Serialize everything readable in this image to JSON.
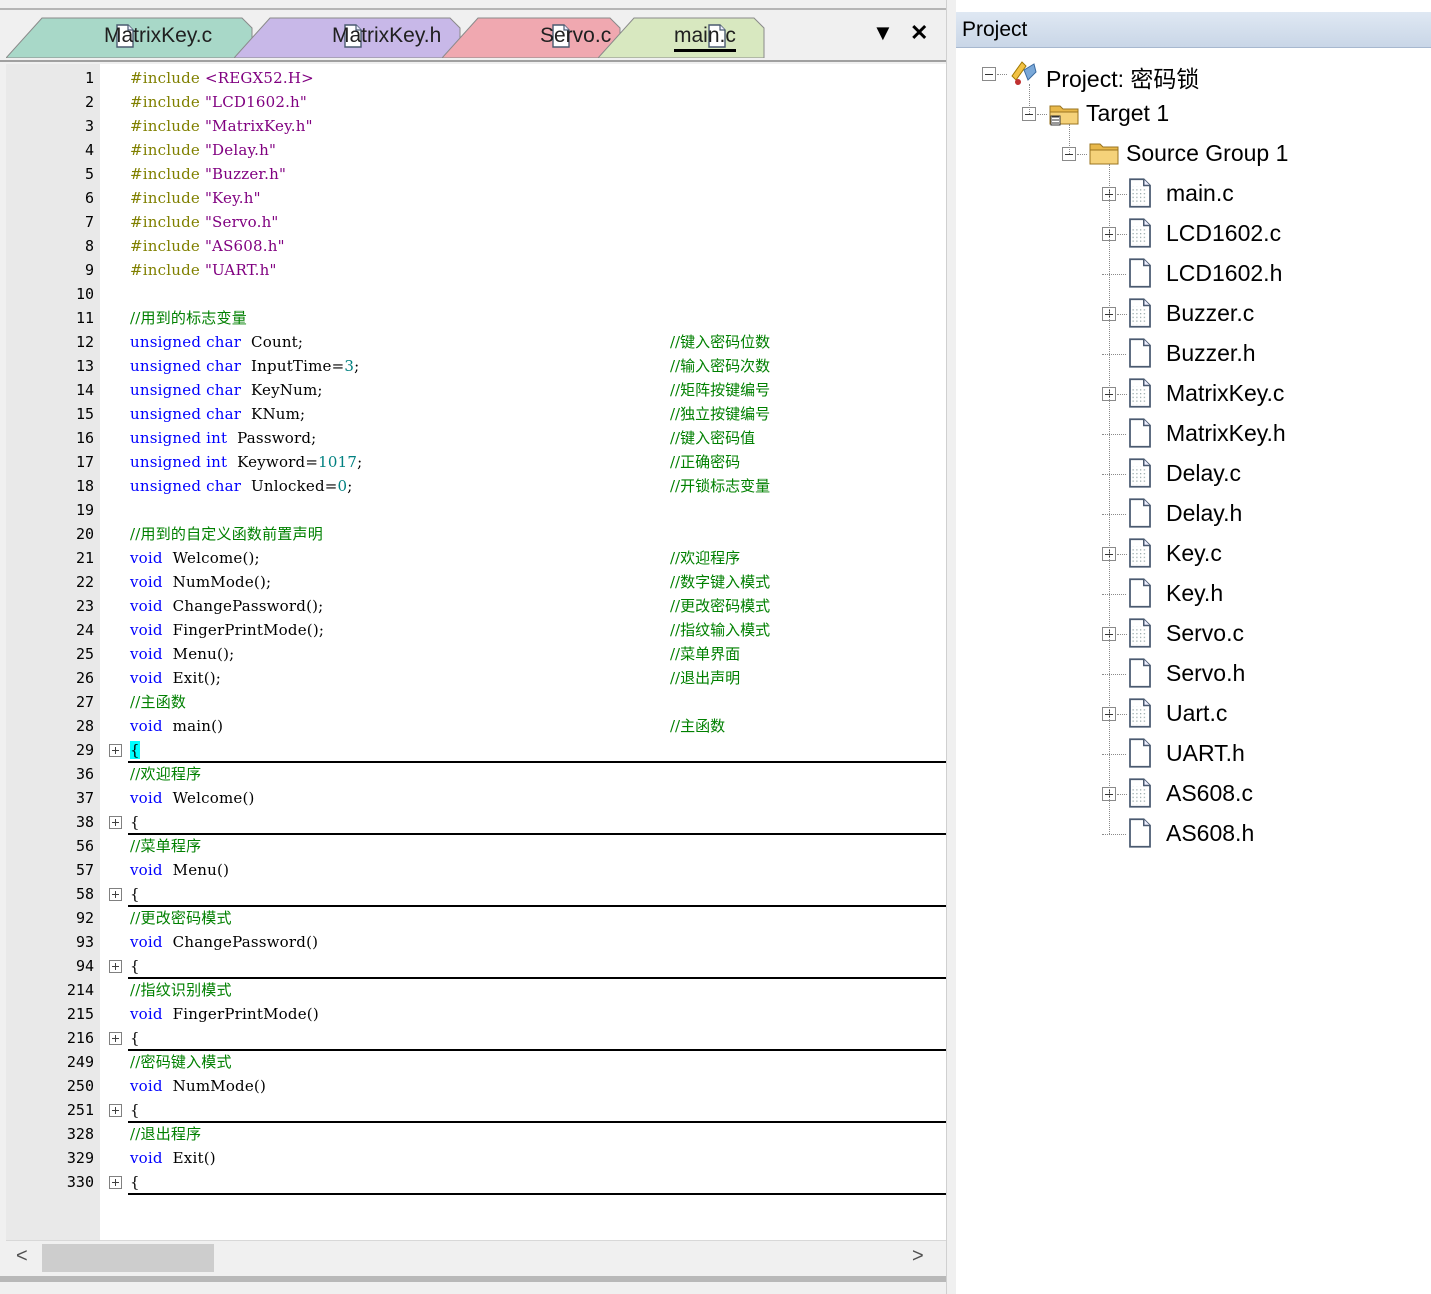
{
  "editor": {
    "tabs": [
      {
        "label": "MatrixKey.c",
        "color": "#a8d8c8"
      },
      {
        "label": "MatrixKey.h",
        "color": "#c8b8e8"
      },
      {
        "label": "Servo.c",
        "color": "#f0a8b0"
      },
      {
        "label": "main.c",
        "color": "#d8e8c0",
        "active": true
      }
    ],
    "dropdown_icon": "▼",
    "close_icon": "✕",
    "lines": [
      {
        "n": "1",
        "html": [
          [
            "pp",
            "#include "
          ],
          [
            "str",
            "&lt;REGX52.H&gt;"
          ]
        ]
      },
      {
        "n": "2",
        "html": [
          [
            "pp",
            "#include "
          ],
          [
            "str",
            "\"LCD1602.h\""
          ]
        ]
      },
      {
        "n": "3",
        "html": [
          [
            "pp",
            "#include "
          ],
          [
            "str",
            "\"MatrixKey.h\""
          ]
        ]
      },
      {
        "n": "4",
        "html": [
          [
            "pp",
            "#include "
          ],
          [
            "str",
            "\"Delay.h\""
          ]
        ]
      },
      {
        "n": "5",
        "html": [
          [
            "pp",
            "#include "
          ],
          [
            "str",
            "\"Buzzer.h\""
          ]
        ]
      },
      {
        "n": "6",
        "html": [
          [
            "pp",
            "#include "
          ],
          [
            "str",
            "\"Key.h\""
          ]
        ]
      },
      {
        "n": "7",
        "html": [
          [
            "pp",
            "#include "
          ],
          [
            "str",
            "\"Servo.h\""
          ]
        ]
      },
      {
        "n": "8",
        "html": [
          [
            "pp",
            "#include "
          ],
          [
            "str",
            "\"AS608.h\""
          ]
        ]
      },
      {
        "n": "9",
        "html": [
          [
            "pp",
            "#include "
          ],
          [
            "str",
            "\"UART.h\""
          ]
        ]
      },
      {
        "n": "10",
        "html": []
      },
      {
        "n": "11",
        "html": [
          [
            "cmt",
            "//用到的标志变量"
          ]
        ]
      },
      {
        "n": "12",
        "html": [
          [
            "kw",
            "unsigned char"
          ],
          [
            "",
            "  Count;"
          ]
        ],
        "cm": "//键入密码位数"
      },
      {
        "n": "13",
        "html": [
          [
            "kw",
            "unsigned char"
          ],
          [
            "",
            "  InputTime="
          ],
          [
            "num",
            "3"
          ],
          [
            "",
            ";"
          ]
        ],
        "cm": "//输入密码次数"
      },
      {
        "n": "14",
        "html": [
          [
            "kw",
            "unsigned char"
          ],
          [
            "",
            "  KeyNum;"
          ]
        ],
        "cm": "//矩阵按键编号"
      },
      {
        "n": "15",
        "html": [
          [
            "kw",
            "unsigned char"
          ],
          [
            "",
            "  KNum;"
          ]
        ],
        "cm": "//独立按键编号"
      },
      {
        "n": "16",
        "html": [
          [
            "kw",
            "unsigned int"
          ],
          [
            "",
            "  Password;"
          ]
        ],
        "cm": "//键入密码值"
      },
      {
        "n": "17",
        "html": [
          [
            "kw",
            "unsigned int"
          ],
          [
            "",
            "  Keyword="
          ],
          [
            "num",
            "1017"
          ],
          [
            "",
            ";"
          ]
        ],
        "cm": "//正确密码"
      },
      {
        "n": "18",
        "html": [
          [
            "kw",
            "unsigned char"
          ],
          [
            "",
            "  Unlocked="
          ],
          [
            "num",
            "0"
          ],
          [
            "",
            ";"
          ]
        ],
        "cm": "//开锁标志变量"
      },
      {
        "n": "19",
        "html": []
      },
      {
        "n": "20",
        "html": [
          [
            "cmt",
            "//用到的自定义函数前置声明"
          ]
        ]
      },
      {
        "n": "21",
        "html": [
          [
            "kw",
            "void"
          ],
          [
            "",
            "  Welcome();"
          ]
        ],
        "cm": "//欢迎程序"
      },
      {
        "n": "22",
        "html": [
          [
            "kw",
            "void"
          ],
          [
            "",
            "  NumMode();"
          ]
        ],
        "cm": "//数字键入模式"
      },
      {
        "n": "23",
        "html": [
          [
            "kw",
            "void"
          ],
          [
            "",
            "  ChangePassword();"
          ]
        ],
        "cm": "//更改密码模式"
      },
      {
        "n": "24",
        "html": [
          [
            "kw",
            "void"
          ],
          [
            "",
            "  FingerPrintMode();"
          ]
        ],
        "cm": "//指纹输入模式"
      },
      {
        "n": "25",
        "html": [
          [
            "kw",
            "void"
          ],
          [
            "",
            "  Menu();"
          ]
        ],
        "cm": "//菜单界面"
      },
      {
        "n": "26",
        "html": [
          [
            "kw",
            "void"
          ],
          [
            "",
            "  Exit();"
          ]
        ],
        "cm": "//退出声明"
      },
      {
        "n": "27",
        "html": [
          [
            "cmt",
            "//主函数"
          ]
        ]
      },
      {
        "n": "28",
        "html": [
          [
            "kw",
            "void"
          ],
          [
            "",
            "  main()"
          ]
        ],
        "cm": "//主函数"
      },
      {
        "n": "29",
        "html": [
          [
            "cur",
            "{"
          ]
        ],
        "fold": true
      },
      {
        "n": "36",
        "html": [
          [
            "cmt",
            "//欢迎程序"
          ]
        ]
      },
      {
        "n": "37",
        "html": [
          [
            "kw",
            "void"
          ],
          [
            "",
            "  Welcome()"
          ]
        ]
      },
      {
        "n": "38",
        "html": [
          [
            "",
            "{"
          ]
        ],
        "fold": true
      },
      {
        "n": "56",
        "html": [
          [
            "cmt",
            "//菜单程序"
          ]
        ]
      },
      {
        "n": "57",
        "html": [
          [
            "kw",
            "void"
          ],
          [
            "",
            "  Menu()"
          ]
        ]
      },
      {
        "n": "58",
        "html": [
          [
            "",
            "{"
          ]
        ],
        "fold": true
      },
      {
        "n": "92",
        "html": [
          [
            "cmt",
            "//更改密码模式"
          ]
        ]
      },
      {
        "n": "93",
        "html": [
          [
            "kw",
            "void"
          ],
          [
            "",
            "  ChangePassword()"
          ]
        ]
      },
      {
        "n": "94",
        "html": [
          [
            "",
            "{"
          ]
        ],
        "fold": true
      },
      {
        "n": "214",
        "html": [
          [
            "cmt",
            "//指纹识别模式"
          ]
        ]
      },
      {
        "n": "215",
        "html": [
          [
            "kw",
            "void"
          ],
          [
            "",
            "  FingerPrintMode()"
          ]
        ]
      },
      {
        "n": "216",
        "html": [
          [
            "",
            "{"
          ]
        ],
        "fold": true
      },
      {
        "n": "249",
        "html": [
          [
            "cmt",
            "//密码键入模式"
          ]
        ]
      },
      {
        "n": "250",
        "html": [
          [
            "kw",
            "void"
          ],
          [
            "",
            "  NumMode()"
          ]
        ]
      },
      {
        "n": "251",
        "html": [
          [
            "",
            "{"
          ]
        ],
        "fold": true
      },
      {
        "n": "328",
        "html": [
          [
            "cmt",
            "//退出程序"
          ]
        ]
      },
      {
        "n": "329",
        "html": [
          [
            "kw",
            "void"
          ],
          [
            "",
            "  Exit()"
          ]
        ]
      },
      {
        "n": "330",
        "html": [
          [
            "",
            "{"
          ]
        ],
        "fold": true
      }
    ],
    "scroll_left": "<",
    "scroll_right": ">"
  },
  "project": {
    "title": "Project",
    "tree": [
      {
        "label": "Project: 密码锁",
        "icon": "project-icon",
        "level": 0,
        "expander": "minus"
      },
      {
        "label": "Target 1",
        "icon": "target-icon",
        "level": 1,
        "expander": "minus"
      },
      {
        "label": "Source Group 1",
        "icon": "folder-icon",
        "level": 2,
        "expander": "minus"
      },
      {
        "label": "main.c",
        "icon": "c-file-icon",
        "level": 3,
        "expander": "plus"
      },
      {
        "label": "LCD1602.c",
        "icon": "c-file-icon",
        "level": 3,
        "expander": "plus"
      },
      {
        "label": "LCD1602.h",
        "icon": "h-file-icon",
        "level": 3,
        "expander": "none"
      },
      {
        "label": "Buzzer.c",
        "icon": "c-file-icon",
        "level": 3,
        "expander": "plus"
      },
      {
        "label": "Buzzer.h",
        "icon": "h-file-icon",
        "level": 3,
        "expander": "none"
      },
      {
        "label": "MatrixKey.c",
        "icon": "c-file-icon",
        "level": 3,
        "expander": "plus"
      },
      {
        "label": "MatrixKey.h",
        "icon": "h-file-icon",
        "level": 3,
        "expander": "none"
      },
      {
        "label": "Delay.c",
        "icon": "c-file-icon",
        "level": 3,
        "expander": "none"
      },
      {
        "label": "Delay.h",
        "icon": "h-file-icon",
        "level": 3,
        "expander": "none"
      },
      {
        "label": "Key.c",
        "icon": "c-file-icon",
        "level": 3,
        "expander": "plus"
      },
      {
        "label": "Key.h",
        "icon": "h-file-icon",
        "level": 3,
        "expander": "none"
      },
      {
        "label": "Servo.c",
        "icon": "c-file-icon",
        "level": 3,
        "expander": "plus"
      },
      {
        "label": "Servo.h",
        "icon": "h-file-icon",
        "level": 3,
        "expander": "none"
      },
      {
        "label": "Uart.c",
        "icon": "c-file-icon",
        "level": 3,
        "expander": "plus"
      },
      {
        "label": "UART.h",
        "icon": "h-file-icon",
        "level": 3,
        "expander": "none"
      },
      {
        "label": "AS608.c",
        "icon": "c-file-icon",
        "level": 3,
        "expander": "plus"
      },
      {
        "label": "AS608.h",
        "icon": "h-file-icon",
        "level": 3,
        "expander": "none"
      }
    ]
  }
}
